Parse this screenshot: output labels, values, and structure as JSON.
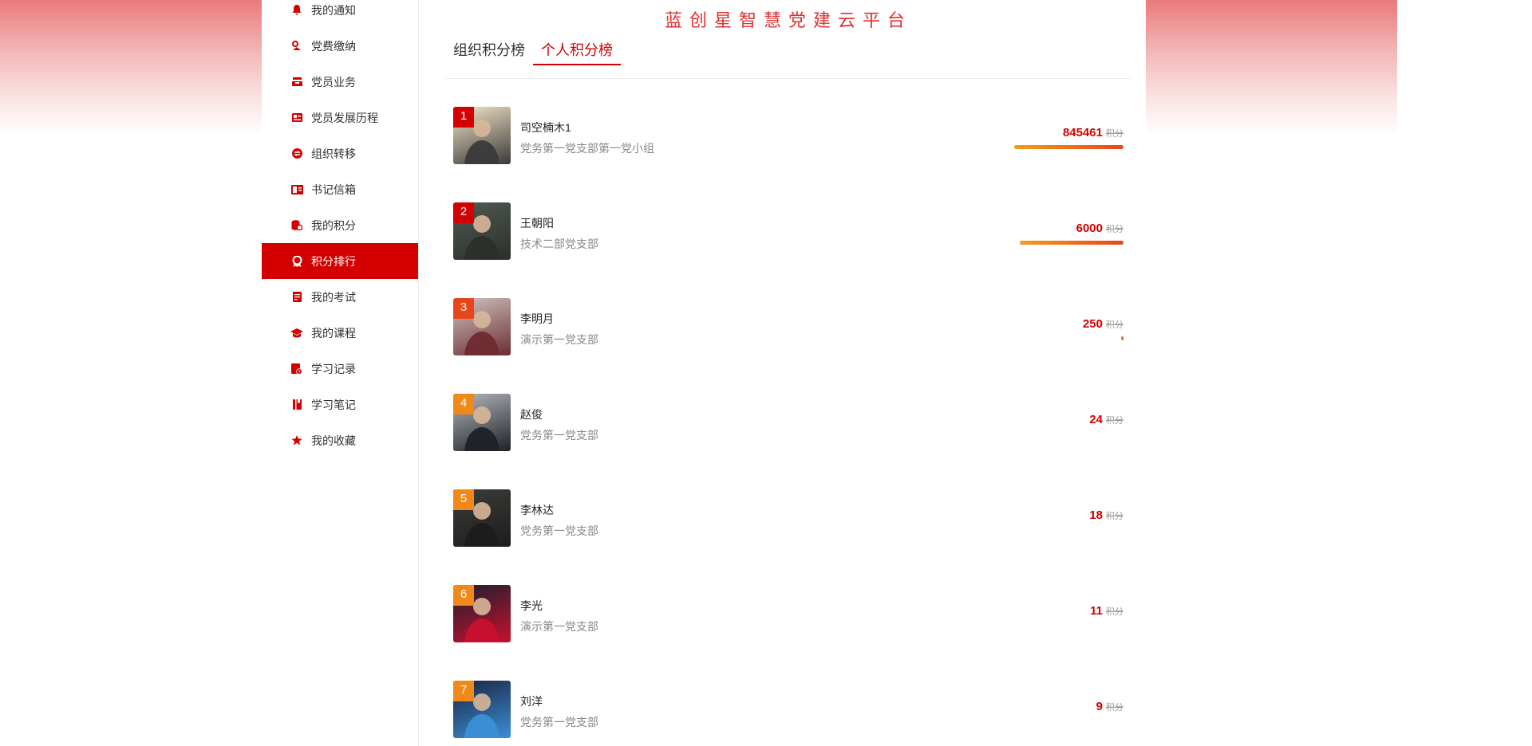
{
  "page": {
    "platform_title": "蓝创星智慧党建云平台",
    "accent_color": "#d40000"
  },
  "sidebar": {
    "items": [
      {
        "label": "我的通知",
        "icon": "bell-icon",
        "active": false
      },
      {
        "label": "党费缴纳",
        "icon": "payment-icon",
        "active": false
      },
      {
        "label": "党员业务",
        "icon": "tray-icon",
        "active": false
      },
      {
        "label": "党员发展历程",
        "icon": "id-card-icon",
        "active": false
      },
      {
        "label": "组织转移",
        "icon": "transfer-icon",
        "active": false
      },
      {
        "label": "书记信箱",
        "icon": "mailbox-icon",
        "active": false
      },
      {
        "label": "我的积分",
        "icon": "coins-icon",
        "active": false
      },
      {
        "label": "积分排行",
        "icon": "ribbon-icon",
        "active": true
      },
      {
        "label": "我的考试",
        "icon": "exam-icon",
        "active": false
      },
      {
        "label": "我的课程",
        "icon": "graduation-cap-icon",
        "active": false
      },
      {
        "label": "学习记录",
        "icon": "record-icon",
        "active": false
      },
      {
        "label": "学习笔记",
        "icon": "notebook-icon",
        "active": false
      },
      {
        "label": "我的收藏",
        "icon": "star-icon",
        "active": false
      }
    ]
  },
  "tabs": [
    {
      "label": "组织积分榜",
      "active": false
    },
    {
      "label": "个人积分榜",
      "active": true
    }
  ],
  "ranking": {
    "unit_label": "积分",
    "rows": [
      {
        "rank": "1",
        "name": "司空楠木1",
        "dept": "党务第一党支部第一党小组",
        "score": "845461",
        "bar_fraction": 1.0,
        "badge_color": "#d40000",
        "avatar_colors": [
          "#3a3a3a",
          "#f4e6c8"
        ]
      },
      {
        "rank": "2",
        "name": "王朝阳",
        "dept": "技术二部党支部",
        "score": "6000",
        "bar_fraction": 0.95,
        "badge_color": "#d40000",
        "avatar_colors": [
          "#2b2f2b",
          "#515a52"
        ]
      },
      {
        "rank": "3",
        "name": "李明月",
        "dept": "演示第一党支部",
        "score": "250",
        "bar_fraction": 0.02,
        "badge_color": "#e8461a",
        "avatar_colors": [
          "#6e2b2f",
          "#cfc6c4"
        ]
      },
      {
        "rank": "4",
        "name": "赵俊",
        "dept": "党务第一党支部",
        "score": "24",
        "bar_fraction": 0,
        "badge_color": "#f0891a",
        "avatar_colors": [
          "#1e2126",
          "#b5b9bf"
        ]
      },
      {
        "rank": "5",
        "name": "李林达",
        "dept": "党务第一党支部",
        "score": "18",
        "bar_fraction": 0,
        "badge_color": "#f0891a",
        "avatar_colors": [
          "#1c1c1c",
          "#3b3e3a"
        ]
      },
      {
        "rank": "6",
        "name": "李光",
        "dept": "演示第一党支部",
        "score": "11",
        "bar_fraction": 0,
        "badge_color": "#f0891a",
        "avatar_colors": [
          "#c8102e",
          "#1b1f2e"
        ]
      },
      {
        "rank": "7",
        "name": "刘洋",
        "dept": "党务第一党支部",
        "score": "9",
        "bar_fraction": 0,
        "badge_color": "#f0891a",
        "avatar_colors": [
          "#3b8fd6",
          "#1a2340"
        ]
      }
    ]
  }
}
